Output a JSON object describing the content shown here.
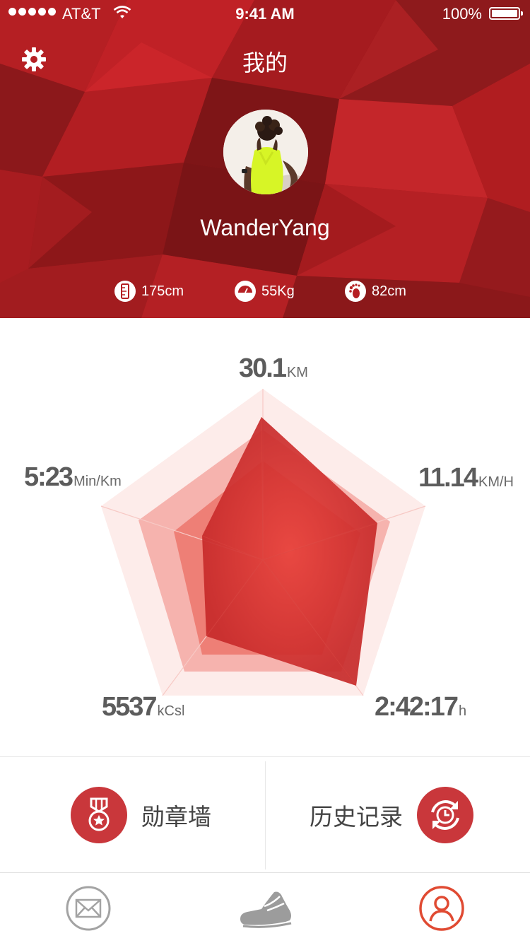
{
  "status_bar": {
    "carrier": "AT&T",
    "time": "9:41 AM",
    "battery": "100%"
  },
  "header": {
    "title": "我的",
    "username": "WanderYang"
  },
  "profile_stats": [
    {
      "icon": "height-icon",
      "value": "175cm"
    },
    {
      "icon": "weight-scale-icon",
      "value": "55Kg"
    },
    {
      "icon": "footprint-icon",
      "value": "82cm"
    }
  ],
  "radar": {
    "distance": {
      "value": "30.1",
      "unit": "KM"
    },
    "speed": {
      "value": "11.14",
      "unit": "KM/H"
    },
    "duration": {
      "value": "2:42:17",
      "unit": "h"
    },
    "calories": {
      "value": "5537",
      "unit": "kCsl"
    },
    "pace": {
      "value": "5:23",
      "unit": "Min/Km"
    }
  },
  "actions": {
    "medal_wall": "勋章墙",
    "history": "历史记录"
  },
  "tabbar": {
    "items": [
      "mail-icon",
      "running-shoe-icon",
      "profile-icon"
    ],
    "active": "profile-icon"
  },
  "colors": {
    "accent": "#c9373b",
    "header_red": "#b41f22",
    "tab_active": "#e04a32",
    "tab_inactive": "#9c9c9c"
  }
}
